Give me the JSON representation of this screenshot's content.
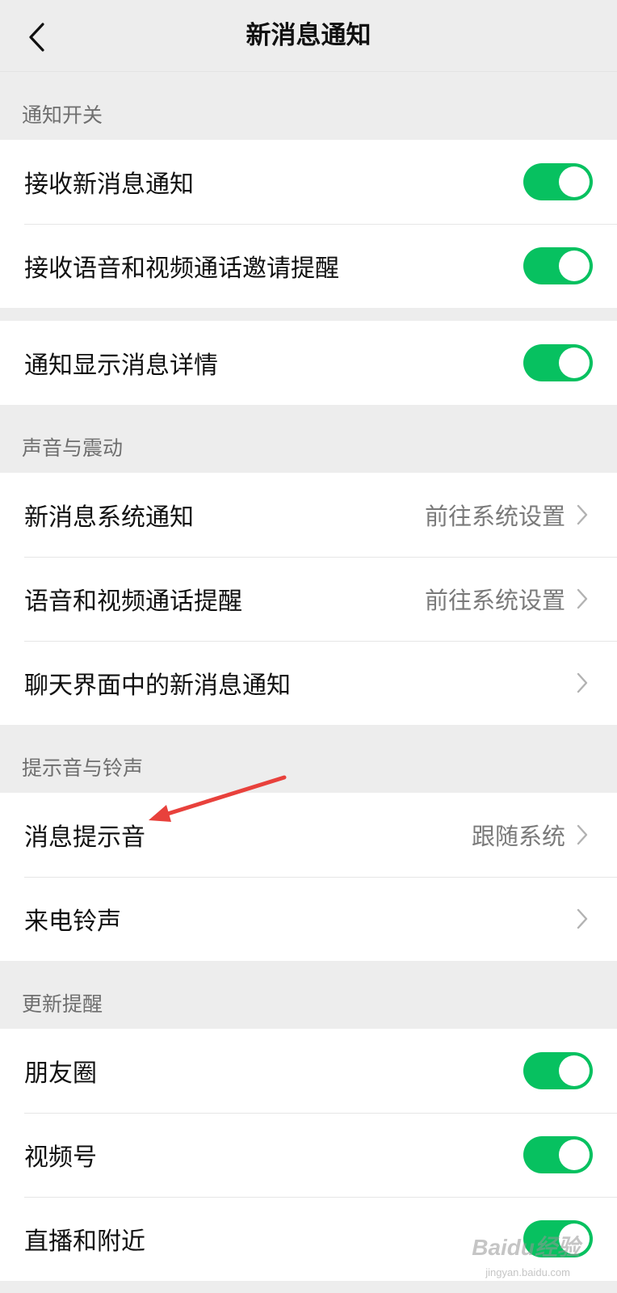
{
  "nav": {
    "back_icon": "chevron-left-icon",
    "title": "新消息通知"
  },
  "colors": {
    "accent": "#07c160",
    "background": "#ededed",
    "annotation_arrow": "#e8413c"
  },
  "sections": {
    "notify_switch": {
      "header": "通知开关",
      "rows": [
        {
          "label": "接收新消息通知",
          "toggle": true
        },
        {
          "label": "接收语音和视频通话邀请提醒",
          "toggle": true
        }
      ]
    },
    "details": {
      "rows": [
        {
          "label": "通知显示消息详情",
          "toggle": true
        }
      ]
    },
    "sound_vibrate": {
      "header": "声音与震动",
      "rows": [
        {
          "label": "新消息系统通知",
          "value": "前往系统设置"
        },
        {
          "label": "语音和视频通话提醒",
          "value": "前往系统设置"
        },
        {
          "label": "聊天界面中的新消息通知",
          "value": ""
        }
      ]
    },
    "tones": {
      "header": "提示音与铃声",
      "rows": [
        {
          "label": "消息提示音",
          "value": "跟随系统"
        },
        {
          "label": "来电铃声",
          "value": ""
        }
      ]
    },
    "updates": {
      "header": "更新提醒",
      "rows": [
        {
          "label": "朋友圈",
          "toggle": true
        },
        {
          "label": "视频号",
          "toggle": true
        },
        {
          "label": "直播和附近",
          "toggle": true
        }
      ]
    }
  },
  "watermark": {
    "text": "Baidu经验",
    "sub": "jingyan.baidu.com"
  }
}
